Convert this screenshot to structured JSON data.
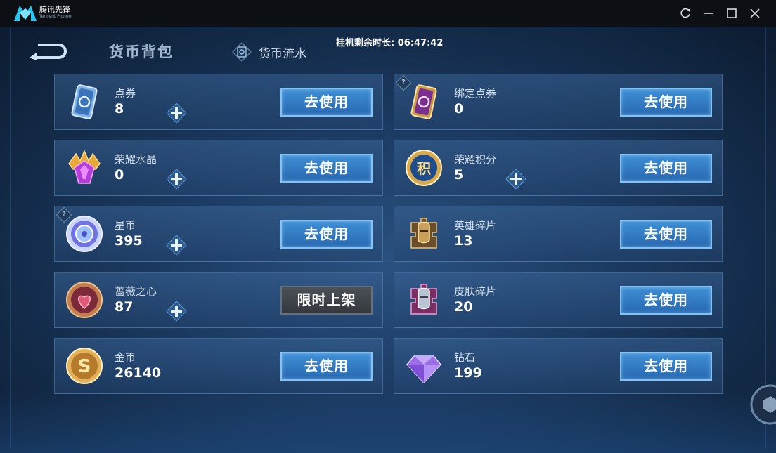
{
  "app": {
    "logo_text": "腾讯先锋",
    "logo_sub": "Tencent Pioneer"
  },
  "header": {
    "tab_active": "货币背包",
    "tab_other": "货币流水",
    "timer_label": "挂机剩余时长: 06:47:42"
  },
  "currencies": {
    "left": [
      {
        "name": "点券",
        "amount": "8",
        "has_plus": true,
        "button": "去使用",
        "icon": "coupon-card-icon"
      },
      {
        "name": "荣耀水晶",
        "amount": "0",
        "has_plus": true,
        "button": "去使用",
        "icon": "glory-crystal-icon"
      },
      {
        "name": "星币",
        "amount": "395",
        "has_plus": true,
        "button": "去使用",
        "icon": "star-coin-icon"
      },
      {
        "name": "蔷薇之心",
        "amount": "87",
        "has_plus": true,
        "button": "限时上架",
        "icon": "rose-heart-icon"
      },
      {
        "name": "金币",
        "amount": "26140",
        "has_plus": false,
        "button": "去使用",
        "icon": "gold-coin-icon"
      }
    ],
    "right": [
      {
        "name": "绑定点券",
        "amount": "0",
        "has_plus": false,
        "button": "去使用",
        "icon": "bound-coupon-icon"
      },
      {
        "name": "荣耀积分",
        "amount": "5",
        "has_plus": true,
        "button": "去使用",
        "icon": "glory-points-icon"
      },
      {
        "name": "英雄碎片",
        "amount": "13",
        "has_plus": false,
        "button": "去使用",
        "icon": "hero-fragment-icon"
      },
      {
        "name": "皮肤碎片",
        "amount": "20",
        "has_plus": false,
        "button": "去使用",
        "icon": "skin-fragment-icon"
      },
      {
        "name": "钻石",
        "amount": "199",
        "has_plus": false,
        "button": "去使用",
        "icon": "diamond-icon"
      }
    ]
  },
  "help_mark": "?",
  "colors": {
    "button_blue": "#2f7cc6",
    "button_border": "#7fc3f7",
    "background": "#1c3b63"
  }
}
